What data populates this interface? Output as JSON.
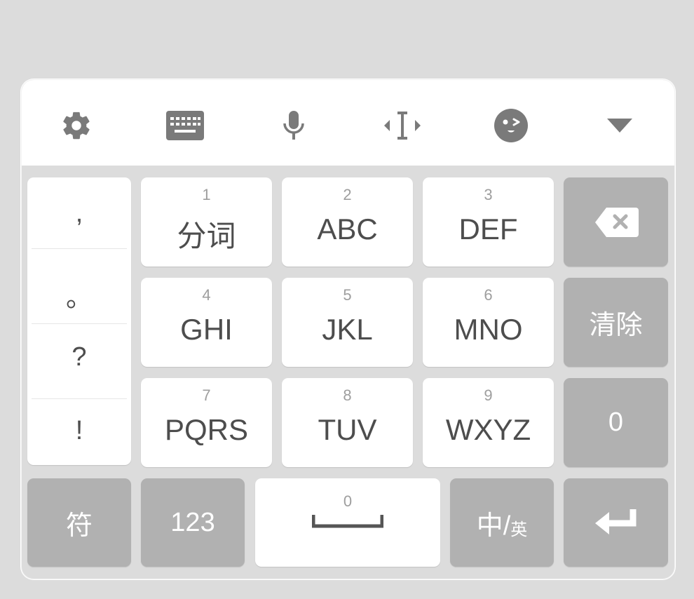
{
  "toolbar": {
    "icons": [
      "gear-icon",
      "keyboard-icon",
      "microphone-icon",
      "cursor-move-icon",
      "emoji-icon",
      "collapse-icon"
    ]
  },
  "punctuation": [
    ",",
    "。",
    "?",
    "!"
  ],
  "keys": {
    "k1": {
      "num": "1",
      "label": "分词"
    },
    "k2": {
      "num": "2",
      "label": "ABC"
    },
    "k3": {
      "num": "3",
      "label": "DEF"
    },
    "k4": {
      "num": "4",
      "label": "GHI"
    },
    "k5": {
      "num": "5",
      "label": "JKL"
    },
    "k6": {
      "num": "6",
      "label": "MNO"
    },
    "k7": {
      "num": "7",
      "label": "PQRS"
    },
    "k8": {
      "num": "8",
      "label": "TUV"
    },
    "k9": {
      "num": "9",
      "label": "WXYZ"
    }
  },
  "side": {
    "clear": "清除",
    "zero": "0"
  },
  "bottom": {
    "symbols": "符",
    "numbers": "123",
    "space_num": "0",
    "lang_zh": "中/",
    "lang_en": "英"
  },
  "colors": {
    "key_bg": "#ffffff",
    "func_key_bg": "#b1b1b1",
    "board_bg": "#dcdcdc",
    "icon_gray": "#7a7a7a"
  }
}
